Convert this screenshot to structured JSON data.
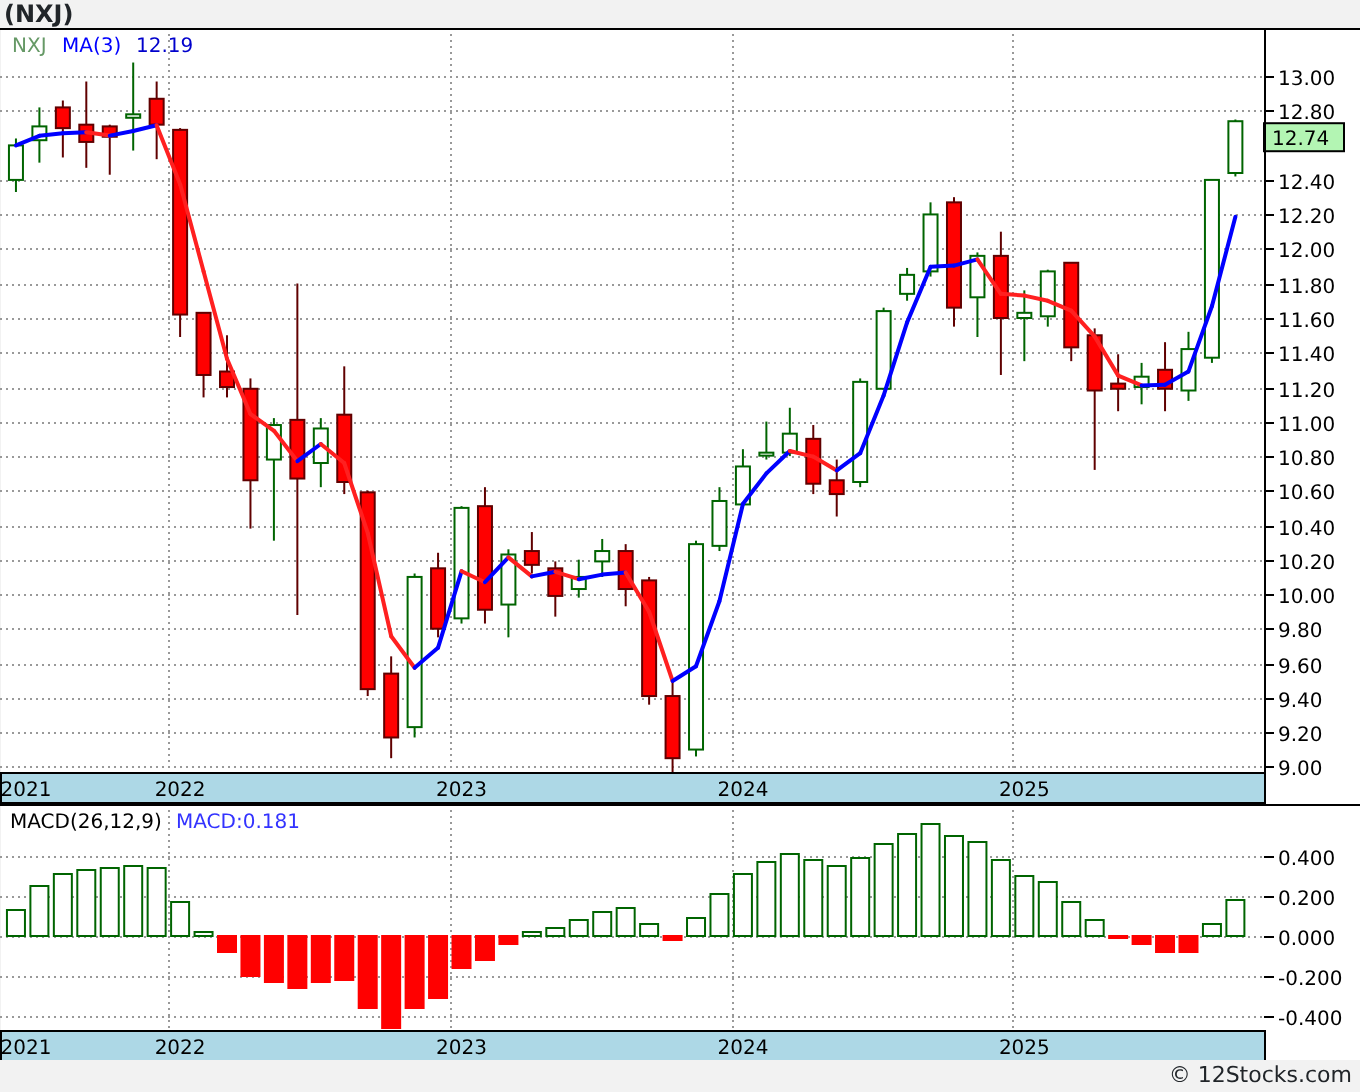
{
  "title": "(NXJ)",
  "price_panel": {
    "legend": {
      "symbol": "NXJ",
      "ma_label": "MA(3)",
      "ma_value": "12.19"
    },
    "last_price": "12.74",
    "chart_data": {
      "type": "candlestick",
      "categories": [
        "2021",
        null,
        null,
        null,
        null,
        null,
        null,
        "2022",
        null,
        null,
        null,
        null,
        null,
        null,
        null,
        null,
        null,
        null,
        null,
        "2023",
        null,
        null,
        null,
        null,
        null,
        null,
        null,
        null,
        null,
        null,
        null,
        "2024",
        null,
        null,
        null,
        null,
        null,
        null,
        null,
        null,
        null,
        null,
        null,
        "2025",
        null,
        null,
        null,
        null,
        null,
        null,
        null,
        null,
        null
      ],
      "ylim": [
        8.97,
        13.28
      ],
      "grid": true,
      "yticks": [
        {
          "value": 9,
          "label": "9.00"
        },
        {
          "value": 9.2,
          "label": "9.20"
        },
        {
          "value": 9.4,
          "label": "9.40"
        },
        {
          "value": 9.6,
          "label": "9.60"
        },
        {
          "value": 9.8,
          "label": "9.80"
        },
        {
          "value": 10,
          "label": "10.00"
        },
        {
          "value": 10.2,
          "label": "10.20"
        },
        {
          "value": 10.4,
          "label": "10.40"
        },
        {
          "value": 10.6,
          "label": "10.60"
        },
        {
          "value": 10.8,
          "label": "10.80"
        },
        {
          "value": 11,
          "label": "11.00"
        },
        {
          "value": 11.2,
          "label": "11.20"
        },
        {
          "value": 11.4,
          "label": "11.40"
        },
        {
          "value": 11.6,
          "label": "11.60"
        },
        {
          "value": 11.8,
          "label": "11.80"
        },
        {
          "value": 12,
          "label": "12.00"
        },
        {
          "value": 12.2,
          "label": "12.20"
        },
        {
          "value": 12.4,
          "label": "12.40"
        },
        {
          "value": 12.8,
          "label": "12.80"
        },
        {
          "value": 13,
          "label": "13.00"
        }
      ],
      "ohlc": [
        [
          12.4,
          12.64,
          12.33,
          12.6
        ],
        [
          12.63,
          12.82,
          12.5,
          12.71
        ],
        [
          12.82,
          12.86,
          12.53,
          12.7
        ],
        [
          12.72,
          12.97,
          12.47,
          12.62
        ],
        [
          12.71,
          12.72,
          12.43,
          12.65
        ],
        [
          12.76,
          13.08,
          12.57,
          12.78
        ],
        [
          12.87,
          12.97,
          12.52,
          12.72
        ],
        [
          12.69,
          12.7,
          11.49,
          11.62
        ],
        [
          11.63,
          11.63,
          11.14,
          11.27
        ],
        [
          11.29,
          11.5,
          11.14,
          11.2
        ],
        [
          11.19,
          11.25,
          10.38,
          10.66
        ],
        [
          10.78,
          11.02,
          10.31,
          10.98
        ],
        [
          11.01,
          11.8,
          9.88,
          10.67
        ],
        [
          10.76,
          11.02,
          10.62,
          10.96
        ],
        [
          11.04,
          11.32,
          10.58,
          10.65
        ],
        [
          10.59,
          10.6,
          9.41,
          9.45
        ],
        [
          9.54,
          9.64,
          9.05,
          9.17
        ],
        [
          9.23,
          10.12,
          9.17,
          10.1
        ],
        [
          10.15,
          10.24,
          9.75,
          9.8
        ],
        [
          9.86,
          10.51,
          9.83,
          10.5
        ],
        [
          10.51,
          10.62,
          9.83,
          9.91
        ],
        [
          9.94,
          10.26,
          9.75,
          10.23
        ],
        [
          10.25,
          10.36,
          10.12,
          10.17
        ],
        [
          10.15,
          10.19,
          9.87,
          9.99
        ],
        [
          10.03,
          10.2,
          9.98,
          10.1
        ],
        [
          10.19,
          10.32,
          10.1,
          10.25
        ],
        [
          10.25,
          10.29,
          9.93,
          10.03
        ],
        [
          10.08,
          10.1,
          9.36,
          9.41
        ],
        [
          9.41,
          9.5,
          8.97,
          9.05
        ],
        [
          9.1,
          10.31,
          9.06,
          10.29
        ],
        [
          10.28,
          10.62,
          10.25,
          10.54
        ],
        [
          10.52,
          10.84,
          10.5,
          10.74
        ],
        [
          10.81,
          11.0,
          10.78,
          10.82
        ],
        [
          10.82,
          11.08,
          10.8,
          10.93
        ],
        [
          10.9,
          10.98,
          10.58,
          10.64
        ],
        [
          10.66,
          10.78,
          10.45,
          10.58
        ],
        [
          10.65,
          11.25,
          10.62,
          11.23
        ],
        [
          11.19,
          11.66,
          11.19,
          11.64
        ],
        [
          11.74,
          11.89,
          11.7,
          11.85
        ],
        [
          11.87,
          12.27,
          11.84,
          12.2
        ],
        [
          12.27,
          12.3,
          11.55,
          11.66
        ],
        [
          11.72,
          11.98,
          11.49,
          11.96
        ],
        [
          11.96,
          12.1,
          11.27,
          11.6
        ],
        [
          11.6,
          11.76,
          11.35,
          11.63
        ],
        [
          11.61,
          11.88,
          11.55,
          11.87
        ],
        [
          11.92,
          11.92,
          11.35,
          11.43
        ],
        [
          11.5,
          11.54,
          10.72,
          11.18
        ],
        [
          11.22,
          11.39,
          11.06,
          11.19
        ],
        [
          11.2,
          11.34,
          11.1,
          11.26
        ],
        [
          11.3,
          11.46,
          11.06,
          11.19
        ],
        [
          11.18,
          11.52,
          11.12,
          11.42
        ],
        [
          11.37,
          12.4,
          11.34,
          12.4
        ],
        [
          12.44,
          12.75,
          12.42,
          12.74
        ]
      ]
    }
  },
  "macd_panel": {
    "legend": {
      "value": "MACD:0.181"
    },
    "chart_data": {
      "type": "bar",
      "categories": [
        "2021",
        null,
        null,
        null,
        null,
        null,
        null,
        "2022",
        null,
        null,
        null,
        null,
        null,
        null,
        null,
        null,
        null,
        null,
        null,
        "2023",
        null,
        null,
        null,
        null,
        null,
        null,
        null,
        null,
        null,
        null,
        null,
        "2024",
        null,
        null,
        null,
        null,
        null,
        null,
        null,
        null,
        null,
        null,
        null,
        "2025",
        null,
        null,
        null,
        null,
        null,
        null,
        null,
        null,
        null
      ],
      "ylim": [
        -0.47,
        0.66
      ],
      "grid": true,
      "yticks": [
        {
          "value": -0.4,
          "label": "-0.400"
        },
        {
          "value": -0.2,
          "label": "-0.200"
        },
        {
          "value": 0,
          "label": "0.000"
        },
        {
          "value": 0.2,
          "label": "0.200"
        },
        {
          "value": 0.4,
          "label": "0.400"
        }
      ],
      "series": [
        {
          "name": "MACD(26,12,9)",
          "color": "#006400",
          "values": [
            0.13,
            0.25,
            0.31,
            0.33,
            0.34,
            0.35,
            0.34,
            0.17,
            0.02,
            null,
            null,
            null,
            null,
            null,
            null,
            null,
            null,
            null,
            null,
            null,
            null,
            null,
            0.02,
            0.04,
            0.08,
            0.12,
            0.14,
            0.06,
            null,
            0.09,
            0.21,
            0.31,
            0.37,
            0.41,
            0.38,
            0.35,
            0.39,
            0.46,
            0.51,
            0.56,
            0.5,
            0.47,
            0.38,
            0.3,
            0.27,
            0.17,
            0.08,
            null,
            null,
            null,
            null,
            0.06,
            0.18
          ]
        },
        {
          "color": "#ff0000",
          "values": [
            null,
            null,
            null,
            null,
            null,
            null,
            null,
            null,
            null,
            -0.08,
            -0.2,
            -0.23,
            -0.26,
            -0.23,
            -0.22,
            -0.36,
            -0.46,
            -0.36,
            -0.31,
            -0.16,
            -0.12,
            -0.04,
            null,
            null,
            null,
            null,
            null,
            null,
            -0.02,
            null,
            null,
            null,
            null,
            null,
            null,
            null,
            null,
            null,
            null,
            null,
            null,
            null,
            null,
            null,
            null,
            null,
            null,
            -0.01,
            -0.04,
            -0.08,
            -0.08,
            null,
            null
          ]
        }
      ]
    }
  },
  "footer": "© 12Stocks.com"
}
